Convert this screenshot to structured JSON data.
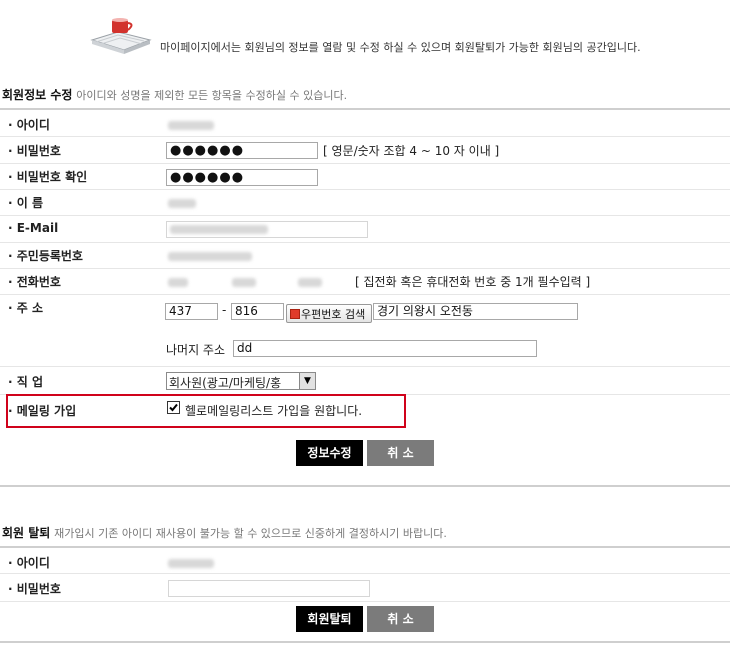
{
  "header": {
    "icon": "open-book-with-cup-icon",
    "intro": "마이페이지에서는 회원님의 정보를 열람 및 수정 하실 수 있으며 회원탈퇴가 가능한 회원님의 공간입니다."
  },
  "edit_section": {
    "title": "회원정보 수정",
    "subtitle": "아이디와 성명을 제외한 모든 항목을 수정하실 수 있습니다.",
    "labels": {
      "id": "· 아이디",
      "password": "· 비밀번호",
      "password_confirm": "· 비밀번호 확인",
      "name": "· 이 름",
      "email": "· E-Mail",
      "resident_no": "· 주민등록번호",
      "phone": "· 전화번호",
      "address": "· 주 소",
      "job": "· 직 업",
      "mailing": "· 메일링 가입"
    },
    "password_value": "●●●●●●",
    "password_hint": "[ 영문/숫자 조합 4 ~ 10 자 이내 ]",
    "password_confirm_value": "●●●●●●",
    "phone_hint": "[ 집전화 혹은 휴대전화 번호 중 1개 필수입력 ]",
    "zip1": "437",
    "zip_dash": "-",
    "zip2": "816",
    "zip_search_label": "우편번호 검색",
    "address1": "경기  의왕시  오전동",
    "address_rest_label": "나머지 주소",
    "address2": "dd",
    "job_selected": "회사원(광고/마케팅/홍",
    "mailing_checked": true,
    "mailing_label": "헬로메일링리스트 가입을 원합니다.",
    "submit_label": "정보수정",
    "cancel_label": "취 소",
    "highlight_color": "#d0021b"
  },
  "withdraw_section": {
    "title": "회원 탈퇴",
    "subtitle": "재가입시 기존 아이디 재사용이 불가능 할 수 있으므로 신중하게 결정하시기 바랍니다.",
    "labels": {
      "id": "· 아이디",
      "password": "· 비밀번호"
    },
    "password_value": "",
    "submit_label": "회원탈퇴",
    "cancel_label": "취 소"
  }
}
